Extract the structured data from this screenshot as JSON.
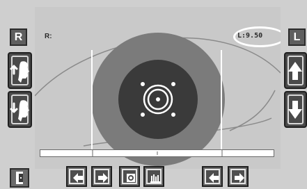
{
  "side_labels": {
    "right_eye": "R",
    "left_eye": "L"
  },
  "view": {
    "top_left_text": "R:",
    "readout": "L:9.50"
  },
  "icons": {
    "exit": "door-exit-icon",
    "face_up": "face-profile-arrow-up-icon",
    "face_down": "face-profile-arrow-down-icon",
    "arrow_up": "arrow-up-icon",
    "arrow_down": "arrow-down-icon",
    "left_arrow": "arrow-left-icon",
    "right_arrow": "arrow-right-icon",
    "capture": "camera-capture-icon",
    "histogram": "histogram-icon"
  },
  "colors": {
    "accent_white": "#ffffff",
    "dark_circle": "#3a3a3a"
  }
}
